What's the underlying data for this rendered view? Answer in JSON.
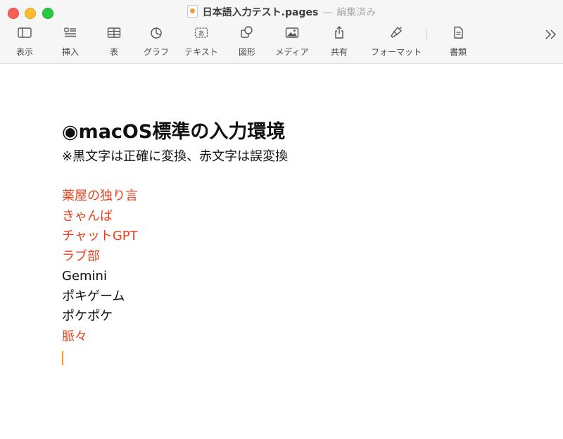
{
  "window": {
    "filename": "日本語入力テスト.pages",
    "separator": "—",
    "status": "編集済み"
  },
  "toolbar": {
    "items": [
      {
        "label": "表示",
        "icon": "sidebar-view-icon"
      },
      {
        "label": "挿入",
        "icon": "insert-list-icon"
      },
      {
        "label": "表",
        "icon": "table-icon"
      },
      {
        "label": "グラフ",
        "icon": "chart-icon"
      },
      {
        "label": "テキスト",
        "icon": "textbox-icon"
      },
      {
        "label": "図形",
        "icon": "shape-icon"
      },
      {
        "label": "メディア",
        "icon": "media-icon"
      },
      {
        "label": "共有",
        "icon": "share-icon"
      },
      {
        "label": "フォーマット",
        "icon": "format-brush-icon"
      },
      {
        "label": "書類",
        "icon": "document-icon"
      }
    ],
    "more_icon": "chevron-double-right-icon"
  },
  "document": {
    "heading": "◉macOS標準の入力環境",
    "note": "※黒文字は正確に変換、赤文字は誤変換",
    "items": [
      {
        "text": "薬屋の独り言",
        "status": "error"
      },
      {
        "text": "きゃんば",
        "status": "error"
      },
      {
        "text": "チャットGPT",
        "status": "error"
      },
      {
        "text": "ラブ部",
        "status": "error"
      },
      {
        "text": "Gemini",
        "status": "correct"
      },
      {
        "text": "ポキゲーム",
        "status": "correct"
      },
      {
        "text": "ポケポケ",
        "status": "correct"
      },
      {
        "text": "脈々",
        "status": "error"
      }
    ]
  },
  "colors": {
    "error_text": "#e8411f",
    "correct_text": "#111111",
    "caret": "#f39a3a",
    "close": "#fe5f57",
    "minimize": "#febc2e",
    "maximize": "#28c840"
  }
}
